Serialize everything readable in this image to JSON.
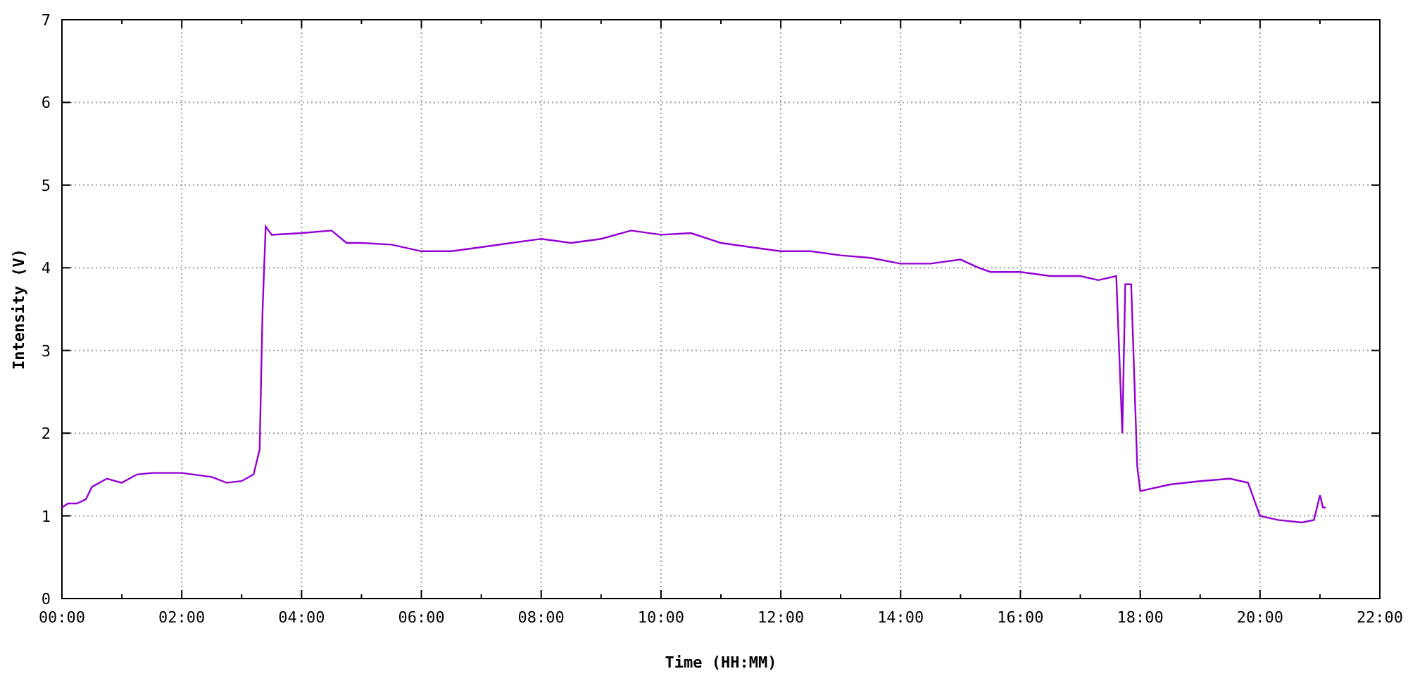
{
  "chart_data": {
    "type": "line",
    "xlabel": "Time (HH:MM)",
    "ylabel": "Intensity (V)",
    "x": [
      0,
      0.1,
      0.25,
      0.4,
      0.5,
      0.75,
      1.0,
      1.25,
      1.5,
      2.0,
      2.5,
      2.75,
      3.0,
      3.2,
      3.3,
      3.35,
      3.4,
      3.5,
      4.0,
      4.5,
      4.75,
      5,
      5.5,
      6,
      6.5,
      7,
      7.5,
      8,
      8.5,
      9,
      9.5,
      10,
      10.5,
      11,
      11.5,
      12,
      12.5,
      13,
      13.5,
      14,
      14.5,
      15,
      15.3,
      15.5,
      16,
      16.5,
      17,
      17.3,
      17.6,
      17.7,
      17.75,
      17.85,
      17.95,
      18.0,
      18.5,
      19,
      19.5,
      19.8,
      20.0,
      20.3,
      20.7,
      20.9,
      21.0,
      21.05,
      21.1
    ],
    "series": [
      {
        "color": "#9400d3",
        "values": [
          1.1,
          1.15,
          1.15,
          1.2,
          1.35,
          1.45,
          1.4,
          1.5,
          1.52,
          1.52,
          1.47,
          1.4,
          1.42,
          1.5,
          1.8,
          3.5,
          4.5,
          4.4,
          4.42,
          4.45,
          4.3,
          4.3,
          4.28,
          4.2,
          4.2,
          4.25,
          4.3,
          4.35,
          4.3,
          4.35,
          4.45,
          4.4,
          4.42,
          4.3,
          4.25,
          4.2,
          4.2,
          4.15,
          4.12,
          4.05,
          4.05,
          4.1,
          4.0,
          3.95,
          3.95,
          3.9,
          3.9,
          3.85,
          3.9,
          2.0,
          3.8,
          3.8,
          1.6,
          1.3,
          1.38,
          1.42,
          1.45,
          1.4,
          1.0,
          0.95,
          0.92,
          0.95,
          1.25,
          1.1,
          1.1
        ]
      }
    ],
    "xlim": [
      0,
      22
    ],
    "ylim": [
      0,
      7
    ],
    "xticks": [
      {
        "value": 0,
        "label": "00:00"
      },
      {
        "value": 2,
        "label": "02:00"
      },
      {
        "value": 4,
        "label": "04:00"
      },
      {
        "value": 6,
        "label": "06:00"
      },
      {
        "value": 8,
        "label": "08:00"
      },
      {
        "value": 10,
        "label": "10:00"
      },
      {
        "value": 12,
        "label": "12:00"
      },
      {
        "value": 14,
        "label": "14:00"
      },
      {
        "value": 16,
        "label": "16:00"
      },
      {
        "value": 18,
        "label": "18:00"
      },
      {
        "value": 20,
        "label": "20:00"
      },
      {
        "value": 22,
        "label": "22:00"
      }
    ],
    "yticks": [
      0,
      1,
      2,
      3,
      4,
      5,
      6,
      7
    ],
    "grid": true
  }
}
